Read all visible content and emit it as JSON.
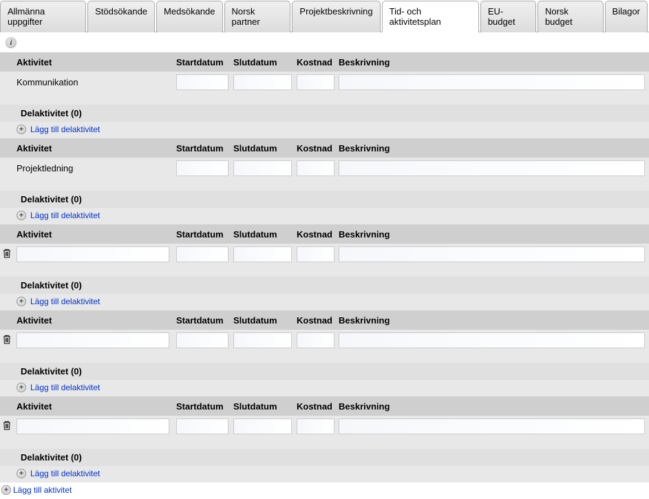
{
  "tabs": [
    {
      "label": "Allmänna uppgifter",
      "active": false
    },
    {
      "label": "Stödsökande",
      "active": false
    },
    {
      "label": "Medsökande",
      "active": false
    },
    {
      "label": "Norsk partner",
      "active": false
    },
    {
      "label": "Projektbeskrivning",
      "active": false
    },
    {
      "label": "Tid- och aktivitetsplan",
      "active": true
    },
    {
      "label": "EU-budget",
      "active": false
    },
    {
      "label": "Norsk budget",
      "active": false
    },
    {
      "label": "Bilagor",
      "active": false
    }
  ],
  "columns": {
    "activity": "Aktivitet",
    "start": "Startdatum",
    "end": "Slutdatum",
    "cost": "Kostnad",
    "desc": "Beskrivning"
  },
  "labels": {
    "subactivity_header": "Delaktivitet (0)",
    "add_subactivity": "Lägg till delaktivitet",
    "add_activity": "Lägg till aktivitet"
  },
  "activities": [
    {
      "name": "Kommunikation",
      "deletable": false,
      "editable_name": false,
      "start": "",
      "end": "",
      "cost": "",
      "desc": ""
    },
    {
      "name": "Projektledning",
      "deletable": false,
      "editable_name": false,
      "start": "",
      "end": "",
      "cost": "",
      "desc": ""
    },
    {
      "name": "",
      "deletable": true,
      "editable_name": true,
      "start": "",
      "end": "",
      "cost": "",
      "desc": ""
    },
    {
      "name": "",
      "deletable": true,
      "editable_name": true,
      "start": "",
      "end": "",
      "cost": "",
      "desc": ""
    },
    {
      "name": "",
      "deletable": true,
      "editable_name": true,
      "start": "",
      "end": "",
      "cost": "",
      "desc": ""
    }
  ]
}
